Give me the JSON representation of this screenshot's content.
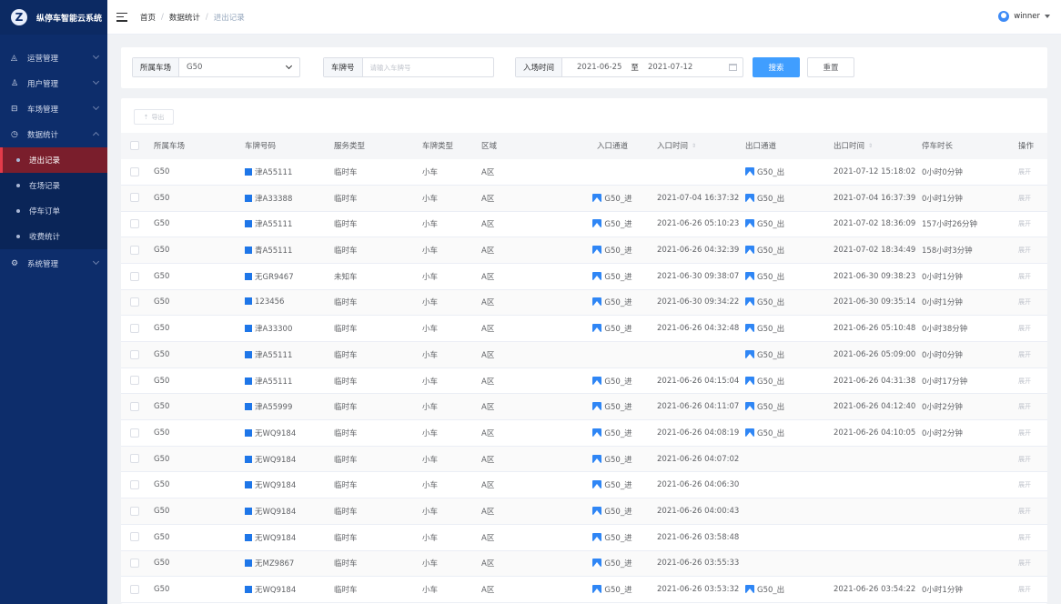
{
  "app": {
    "title": "纵停车智能云系统",
    "logo_icon": "logo-icon"
  },
  "sidebar": {
    "items": [
      {
        "label": "运营管理",
        "icon": "operations-icon"
      },
      {
        "label": "用户管理",
        "icon": "user-icon"
      },
      {
        "label": "车场管理",
        "icon": "car-icon"
      },
      {
        "label": "数据统计",
        "icon": "clock-icon"
      }
    ],
    "sub_items": [
      {
        "label": "进出记录"
      },
      {
        "label": "在场记录"
      },
      {
        "label": "停车订单"
      },
      {
        "label": "收费统计"
      }
    ],
    "system": {
      "label": "系统管理",
      "icon": "gear-icon"
    }
  },
  "header": {
    "breadcrumb": [
      "首页",
      "数据统计",
      "进出记录"
    ],
    "breadcrumb_sep": "/",
    "username": "winner"
  },
  "filter": {
    "lot_label": "所属车场",
    "lot_value": "G50",
    "plate_label": "车牌号",
    "plate_placeholder": "请输入车牌号",
    "time_label": "入场时间",
    "date_from": "2021-06-25",
    "date_sep": "至",
    "date_to": "2021-07-12",
    "search": "搜索",
    "reset": "重置"
  },
  "toolbar": {
    "export": "导出",
    "export_icon": "upload-icon"
  },
  "table": {
    "columns": [
      "所属车场",
      "车牌号码",
      "服务类型",
      "车牌类型",
      "区域",
      "入口通道",
      "入口时间",
      "出口通道",
      "出口时间",
      "停车时长",
      "操作"
    ],
    "sort_glyph": "⇕",
    "action_label": "展开",
    "rows": [
      {
        "lot": "G50",
        "plate": "津A55111",
        "service": "临时车",
        "plate_type": "小车",
        "zone": "A区",
        "entry": "",
        "entry_time": "",
        "exit": "G50_出",
        "exit_time": "2021-07-12 15:18:02",
        "duration": "0小时0分钟"
      },
      {
        "lot": "G50",
        "plate": "津A33388",
        "service": "临时车",
        "plate_type": "小车",
        "zone": "A区",
        "entry": "G50_进",
        "entry_time": "2021-07-04 16:37:32",
        "exit": "G50_出",
        "exit_time": "2021-07-04 16:37:39",
        "duration": "0小时1分钟"
      },
      {
        "lot": "G50",
        "plate": "津A55111",
        "service": "临时车",
        "plate_type": "小车",
        "zone": "A区",
        "entry": "G50_进",
        "entry_time": "2021-06-26 05:10:23",
        "exit": "G50_出",
        "exit_time": "2021-07-02 18:36:09",
        "duration": "157小时26分钟"
      },
      {
        "lot": "G50",
        "plate": "青A55111",
        "service": "临时车",
        "plate_type": "小车",
        "zone": "A区",
        "entry": "G50_进",
        "entry_time": "2021-06-26 04:32:39",
        "exit": "G50_出",
        "exit_time": "2021-07-02 18:34:49",
        "duration": "158小时3分钟"
      },
      {
        "lot": "G50",
        "plate": "无GR9467",
        "service": "未知车",
        "plate_type": "小车",
        "zone": "A区",
        "entry": "G50_进",
        "entry_time": "2021-06-30 09:38:07",
        "exit": "G50_出",
        "exit_time": "2021-06-30 09:38:23",
        "duration": "0小时1分钟"
      },
      {
        "lot": "G50",
        "plate": "123456",
        "service": "临时车",
        "plate_type": "小车",
        "zone": "A区",
        "entry": "G50_进",
        "entry_time": "2021-06-30 09:34:22",
        "exit": "G50_出",
        "exit_time": "2021-06-30 09:35:14",
        "duration": "0小时1分钟"
      },
      {
        "lot": "G50",
        "plate": "津A33300",
        "service": "临时车",
        "plate_type": "小车",
        "zone": "A区",
        "entry": "G50_进",
        "entry_time": "2021-06-26 04:32:48",
        "exit": "G50_出",
        "exit_time": "2021-06-26 05:10:48",
        "duration": "0小时38分钟"
      },
      {
        "lot": "G50",
        "plate": "津A55111",
        "service": "临时车",
        "plate_type": "小车",
        "zone": "A区",
        "entry": "",
        "entry_time": "",
        "exit": "G50_出",
        "exit_time": "2021-06-26 05:09:00",
        "duration": "0小时0分钟"
      },
      {
        "lot": "G50",
        "plate": "津A55111",
        "service": "临时车",
        "plate_type": "小车",
        "zone": "A区",
        "entry": "G50_进",
        "entry_time": "2021-06-26 04:15:04",
        "exit": "G50_出",
        "exit_time": "2021-06-26 04:31:38",
        "duration": "0小时17分钟"
      },
      {
        "lot": "G50",
        "plate": "津A55999",
        "service": "临时车",
        "plate_type": "小车",
        "zone": "A区",
        "entry": "G50_进",
        "entry_time": "2021-06-26 04:11:07",
        "exit": "G50_出",
        "exit_time": "2021-06-26 04:12:40",
        "duration": "0小时2分钟"
      },
      {
        "lot": "G50",
        "plate": "无WQ9184",
        "service": "临时车",
        "plate_type": "小车",
        "zone": "A区",
        "entry": "G50_进",
        "entry_time": "2021-06-26 04:08:19",
        "exit": "G50_出",
        "exit_time": "2021-06-26 04:10:05",
        "duration": "0小时2分钟"
      },
      {
        "lot": "G50",
        "plate": "无WQ9184",
        "service": "临时车",
        "plate_type": "小车",
        "zone": "A区",
        "entry": "G50_进",
        "entry_time": "2021-06-26 04:07:02",
        "exit": "",
        "exit_time": "",
        "duration": ""
      },
      {
        "lot": "G50",
        "plate": "无WQ9184",
        "service": "临时车",
        "plate_type": "小车",
        "zone": "A区",
        "entry": "G50_进",
        "entry_time": "2021-06-26 04:06:30",
        "exit": "",
        "exit_time": "",
        "duration": ""
      },
      {
        "lot": "G50",
        "plate": "无WQ9184",
        "service": "临时车",
        "plate_type": "小车",
        "zone": "A区",
        "entry": "G50_进",
        "entry_time": "2021-06-26 04:00:43",
        "exit": "",
        "exit_time": "",
        "duration": ""
      },
      {
        "lot": "G50",
        "plate": "无WQ9184",
        "service": "临时车",
        "plate_type": "小车",
        "zone": "A区",
        "entry": "G50_进",
        "entry_time": "2021-06-26 03:58:48",
        "exit": "",
        "exit_time": "",
        "duration": ""
      },
      {
        "lot": "G50",
        "plate": "无MZ9867",
        "service": "临时车",
        "plate_type": "小车",
        "zone": "A区",
        "entry": "G50_进",
        "entry_time": "2021-06-26 03:55:33",
        "exit": "",
        "exit_time": "",
        "duration": ""
      },
      {
        "lot": "G50",
        "plate": "无WQ9184",
        "service": "临时车",
        "plate_type": "小车",
        "zone": "A区",
        "entry": "G50_进",
        "entry_time": "2021-06-26 03:53:32",
        "exit": "G50_出",
        "exit_time": "2021-06-26 03:54:22",
        "duration": "0小时1分钟"
      }
    ]
  },
  "colors": {
    "sidebar_bg": "#0d2d6b",
    "active_item_bg": "#7a1e2c",
    "primary": "#409eff",
    "plate_blue": "#1e76e8"
  }
}
